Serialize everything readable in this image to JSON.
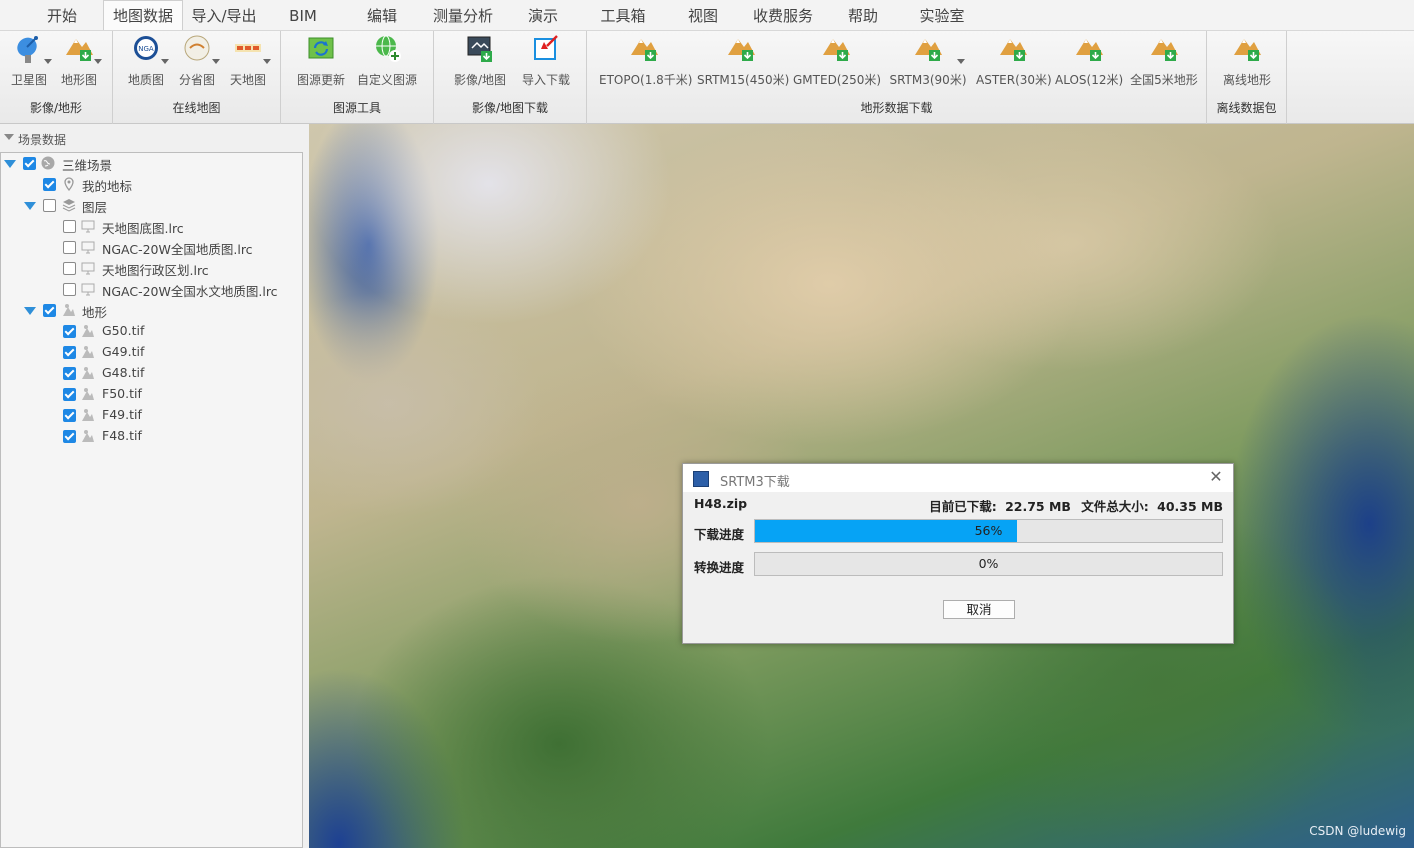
{
  "menu": {
    "items": [
      {
        "label": "开始",
        "active": false
      },
      {
        "label": "地图数据",
        "active": true
      },
      {
        "label": "导入/导出",
        "active": false
      },
      {
        "label": "BIM",
        "active": false
      },
      {
        "label": "编辑",
        "active": false
      },
      {
        "label": "测量分析",
        "active": false
      },
      {
        "label": "演示",
        "active": false
      },
      {
        "label": "工具箱",
        "active": false
      },
      {
        "label": "视图",
        "active": false
      },
      {
        "label": "收费服务",
        "active": false
      },
      {
        "label": "帮助",
        "active": false
      },
      {
        "label": "实验室",
        "active": false
      }
    ]
  },
  "ribbon": {
    "groups": [
      {
        "label": "影像/地形",
        "buttons": [
          {
            "label": "卫星图",
            "icon": "satellite-dish-icon"
          },
          {
            "label": "地形图",
            "icon": "terrain-download-icon"
          }
        ]
      },
      {
        "label": "在线地图",
        "buttons": [
          {
            "label": "地质图",
            "icon": "nga-icon"
          },
          {
            "label": "分省图",
            "icon": "province-map-icon"
          },
          {
            "label": "天地图",
            "icon": "tianditu-icon"
          }
        ]
      },
      {
        "label": "图源工具",
        "buttons": [
          {
            "label": "图源更新",
            "icon": "refresh-map-icon"
          },
          {
            "label": "自定义图源",
            "icon": "globe-add-icon"
          }
        ]
      },
      {
        "label": "影像/地图下载",
        "buttons": [
          {
            "label": "影像/地图",
            "icon": "image-download-icon"
          },
          {
            "label": "导入下载",
            "icon": "import-download-icon"
          }
        ]
      },
      {
        "label": "地形数据下载",
        "buttons": [
          {
            "label": "ETOPO(1.8千米)"
          },
          {
            "label": "SRTM15(450米)"
          },
          {
            "label": "GMTED(250米)"
          },
          {
            "label": "SRTM3(90米)"
          },
          {
            "label": "ASTER(30米)"
          },
          {
            "label": "ALOS(12米)"
          },
          {
            "label": "全国5米地形"
          }
        ]
      },
      {
        "label": "离线数据包",
        "buttons": [
          {
            "label": "离线地形"
          }
        ]
      }
    ]
  },
  "panel": {
    "title": "场景数据",
    "tree": [
      {
        "label": "三维场景",
        "checked": true
      },
      {
        "label": "我的地标",
        "checked": true
      },
      {
        "label": "图层",
        "checked": false
      },
      {
        "label": "天地图底图.lrc",
        "checked": false
      },
      {
        "label": "NGAC-20W全国地质图.lrc",
        "checked": false
      },
      {
        "label": "天地图行政区划.lrc",
        "checked": false
      },
      {
        "label": "NGAC-20W全国水文地质图.lrc",
        "checked": false
      },
      {
        "label": "地形",
        "checked": true
      },
      {
        "label": "G50.tif",
        "checked": true
      },
      {
        "label": "G49.tif",
        "checked": true
      },
      {
        "label": "G48.tif",
        "checked": true
      },
      {
        "label": "F50.tif",
        "checked": true
      },
      {
        "label": "F49.tif",
        "checked": true
      },
      {
        "label": "F48.tif",
        "checked": true
      }
    ]
  },
  "dialog": {
    "title": "SRTM3下载",
    "file": "H48.zip",
    "downloaded_label": "目前已下载:",
    "downloaded_value": "22.75 MB",
    "total_label": "文件总大小:",
    "total_value": "40.35 MB",
    "download_progress_label": "下载进度",
    "download_progress": 56,
    "download_progress_text": "56%",
    "convert_progress_label": "转换进度",
    "convert_progress": 0,
    "convert_progress_text": "0%",
    "cancel_label": "取消"
  },
  "watermark": "CSDN @ludewig",
  "colors": {
    "progress_fill": "#06a3f5",
    "check_blue": "#1e88e5",
    "expand_arrow": "#2f8fd8"
  }
}
